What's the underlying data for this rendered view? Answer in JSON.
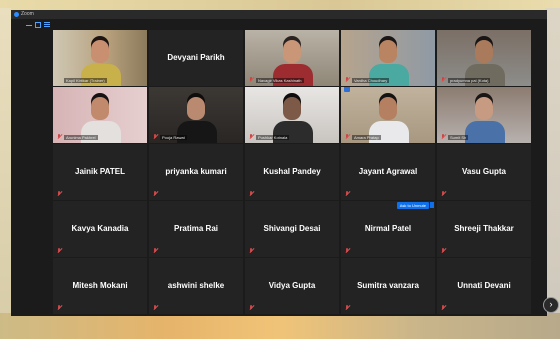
{
  "window": {
    "title": "Zoom",
    "toolbar_icons": [
      "minimize-icon",
      "gallery-view-icon",
      "speaker-view-icon"
    ]
  },
  "tiles": [
    {
      "row": 0,
      "col": 0,
      "type": "video",
      "tag": "Kapil Kirtikar (Trainer)",
      "muted": false,
      "active": true,
      "scene": "woman-waving"
    },
    {
      "row": 0,
      "col": 1,
      "type": "name",
      "name": "Devyani Parikh",
      "muted": false
    },
    {
      "row": 0,
      "col": 2,
      "type": "video",
      "tag": "Navagir Vikas Kashinath",
      "muted": true,
      "scene": "man-red"
    },
    {
      "row": 0,
      "col": 3,
      "type": "video",
      "tag": "Vardha Choudhary",
      "muted": true,
      "scene": "young-man-green"
    },
    {
      "row": 0,
      "col": 4,
      "type": "video",
      "tag": "pradyumna pal (Kota)",
      "muted": true,
      "scene": "man-uniform"
    },
    {
      "row": 1,
      "col": 0,
      "type": "video",
      "tag": "Arunima Pakhrel",
      "muted": true,
      "scene": "woman-pink-wall"
    },
    {
      "row": 1,
      "col": 1,
      "type": "video",
      "tag": "Pooja Rawat",
      "muted": true,
      "scene": "woman-glasses"
    },
    {
      "row": 1,
      "col": 2,
      "type": "video",
      "tag": "Pushkar Kotnala",
      "muted": true,
      "scene": "man-dark-room"
    },
    {
      "row": 1,
      "col": 3,
      "type": "video",
      "tag": "Amara Pratap",
      "muted": true,
      "scene": "young-man-white",
      "raised": true
    },
    {
      "row": 1,
      "col": 4,
      "type": "video",
      "tag": "Sumit Sh",
      "muted": true,
      "scene": "hand-room"
    },
    {
      "row": 2,
      "col": 0,
      "type": "name",
      "name": "Jainik PATEL",
      "muted": true
    },
    {
      "row": 2,
      "col": 1,
      "type": "name",
      "name": "priyanka kumari",
      "muted": true
    },
    {
      "row": 2,
      "col": 2,
      "type": "name",
      "name": "Kushal Pandey",
      "muted": true
    },
    {
      "row": 2,
      "col": 3,
      "type": "name",
      "name": "Jayant Agrawal",
      "muted": true
    },
    {
      "row": 2,
      "col": 4,
      "type": "name",
      "name": "Vasu Gupta",
      "muted": true
    },
    {
      "row": 3,
      "col": 0,
      "type": "name",
      "name": "Kavya Kanadia",
      "muted": true
    },
    {
      "row": 3,
      "col": 1,
      "type": "name",
      "name": "Pratima Rai",
      "muted": true
    },
    {
      "row": 3,
      "col": 2,
      "type": "name",
      "name": "Shivangi Desai",
      "muted": true
    },
    {
      "row": 3,
      "col": 3,
      "type": "name",
      "name": "Nirmal Patel",
      "muted": true,
      "ask_unmute": "Ask to Unmute"
    },
    {
      "row": 3,
      "col": 4,
      "type": "name",
      "name": "Shreeji Thakkar",
      "muted": true
    },
    {
      "row": 4,
      "col": 0,
      "type": "name",
      "name": "Mitesh Mokani",
      "muted": true
    },
    {
      "row": 4,
      "col": 1,
      "type": "name",
      "name": "ashwini shelke",
      "muted": true
    },
    {
      "row": 4,
      "col": 2,
      "type": "name",
      "name": "Vidya Gupta",
      "muted": true
    },
    {
      "row": 4,
      "col": 3,
      "type": "name",
      "name": "Sumitra vanzara",
      "muted": true
    },
    {
      "row": 4,
      "col": 4,
      "type": "name",
      "name": "Unnati Devani",
      "muted": true
    }
  ],
  "controls": {
    "next_page": "›"
  },
  "colors": {
    "tile_bg": "#232323",
    "active_border": "#b7d45f",
    "accent": "#0e71eb",
    "mute": "#e05050"
  }
}
